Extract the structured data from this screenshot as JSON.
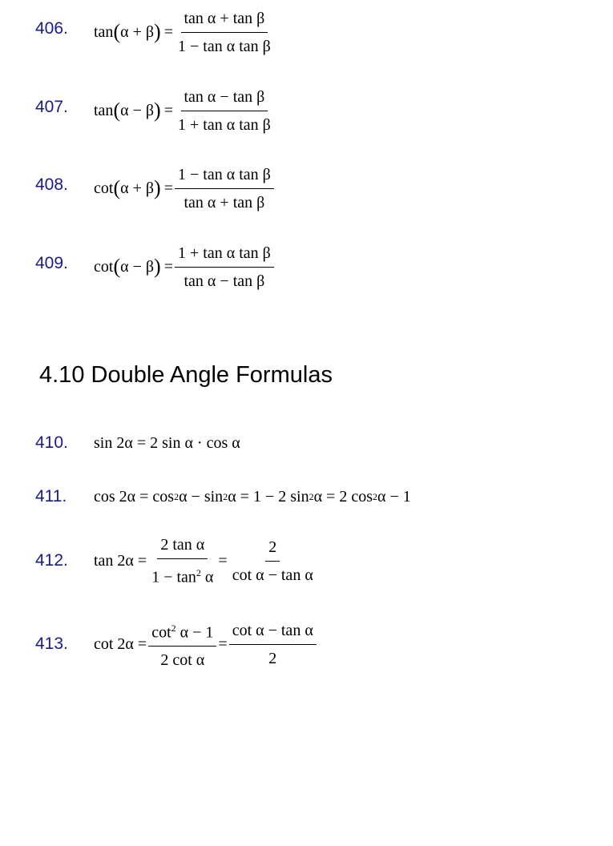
{
  "section_heading": "4.10 Double Angle Formulas",
  "formulas": [
    {
      "num": "406.",
      "lhs": "tan",
      "arg_open": "(",
      "arg": "α + β",
      "arg_close": ")",
      "eq": "=",
      "num_text": "tan α + tan β",
      "den_text": "1 − tan α tan β"
    },
    {
      "num": "407.",
      "lhs": "tan",
      "arg_open": "(",
      "arg": "α − β",
      "arg_close": ")",
      "eq": "=",
      "num_text": "tan α − tan β",
      "den_text": "1 + tan α tan β"
    },
    {
      "num": "408.",
      "lhs": "cot",
      "arg_open": "(",
      "arg": "α + β",
      "arg_close": ")",
      "eq": "=",
      "num_text": "1 − tan α tan β",
      "den_text": "tan α + tan β"
    },
    {
      "num": "409.",
      "lhs": "cot",
      "arg_open": "(",
      "arg": "α − β",
      "arg_close": ")",
      "eq": "=",
      "num_text": "1 + tan α tan β",
      "den_text": "tan α − tan β"
    }
  ],
  "double_angle": {
    "f410": {
      "num": "410.",
      "text": "sin 2α = 2 sin α · cos α"
    },
    "f411": {
      "num": "411.",
      "p1": "cos 2α = cos",
      "s1": "2",
      "p2": " α − sin",
      "s2": "2",
      "p3": " α = 1 − 2 sin",
      "s3": "2",
      "p4": " α = 2 cos",
      "s4": "2",
      "p5": " α − 1"
    },
    "f412": {
      "num": "412.",
      "lhs": "tan 2α =",
      "eq2": "=",
      "frac1_top": "2 tan α",
      "frac1_bot_a": "1 − tan",
      "frac1_bot_sup": "2",
      "frac1_bot_b": " α",
      "frac2_top": "2",
      "frac2_bot": "cot α − tan α"
    },
    "f413": {
      "num": "413.",
      "lhs": "cot 2α =",
      "eq2": "=",
      "frac1_top_a": "cot",
      "frac1_top_sup": "2",
      "frac1_top_b": " α − 1",
      "frac1_bot": "2 cot α",
      "frac2_top": "cot α − tan α",
      "frac2_bot": "2"
    }
  }
}
